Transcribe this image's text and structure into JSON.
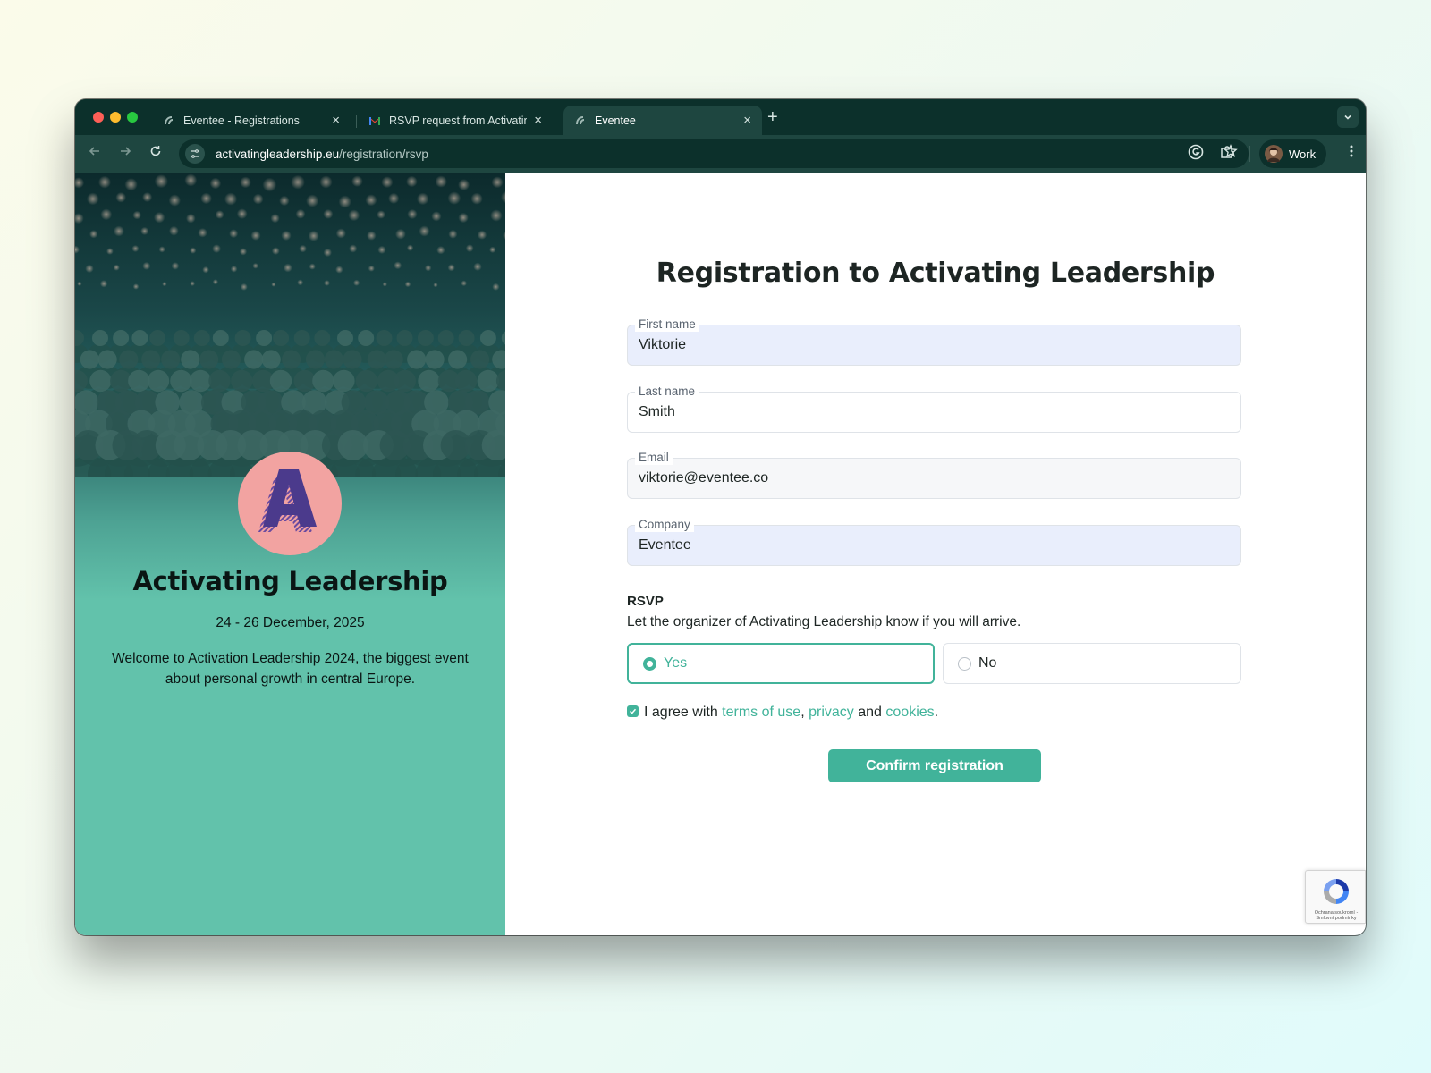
{
  "browser": {
    "tabs": [
      {
        "title": "Eventee - Registrations",
        "close": "×"
      },
      {
        "title": "RSVP request from Activating Leadership",
        "close": "×"
      },
      {
        "title": "Eventee",
        "close": "×"
      }
    ],
    "new_tab": "+",
    "url_domain": "activatingleadership.eu",
    "url_path": "/registration/rsvp",
    "profile_name": "Work"
  },
  "event": {
    "logo_letter": "A",
    "name": "Activating Leadership",
    "dates": "24 - 26 December, 2025",
    "description": "Welcome to Activation Leadership 2024, the biggest event about personal growth in central Europe."
  },
  "form": {
    "title": "Registration to Activating Leadership",
    "fields": [
      {
        "label": "First name",
        "value": "Viktorie"
      },
      {
        "label": "Last name",
        "value": "Smith"
      },
      {
        "label": "Email",
        "value": "viktorie@eventee.co"
      },
      {
        "label": "Company",
        "value": "Eventee"
      }
    ],
    "rsvp": {
      "heading": "RSVP",
      "subtitle": "Let the organizer of Activating Leadership know if you will arrive.",
      "options": [
        {
          "label": "Yes",
          "selected": true
        },
        {
          "label": "No",
          "selected": false
        }
      ]
    },
    "agreement": {
      "checked": true,
      "prefix": "I agree with",
      "terms": "terms of use",
      "comma": ",",
      "privacy": "privacy",
      "and": "and",
      "cookies": "cookies",
      "period": "."
    },
    "submit_label": "Confirm registration"
  },
  "recaptcha": {
    "text": "Ochrana soukromí - Smluvní podmínky"
  },
  "colors": {
    "accent": "#41b39a",
    "panel": "#62c2ab",
    "logo_circle": "#f2a3a1",
    "logo_letter": "#4b3a8c",
    "browser_frame": "#0c302b"
  },
  "icons": [
    "back-arrow-icon",
    "forward-arrow-icon",
    "reload-icon",
    "site-info-icon",
    "bookmark-star-icon",
    "grammarly-icon",
    "extensions-puzzle-icon",
    "kebab-menu-icon",
    "chevron-down-icon",
    "gmail-icon",
    "eventee-favicon-icon",
    "recaptcha-icon"
  ]
}
